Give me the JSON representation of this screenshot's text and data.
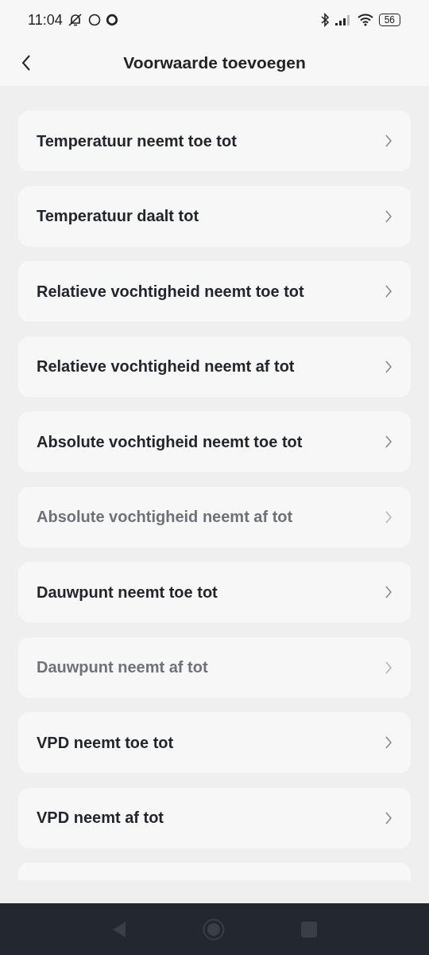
{
  "status_bar": {
    "time": "11:04",
    "battery": "56"
  },
  "header": {
    "title": "Voorwaarde toevoegen"
  },
  "conditions": [
    {
      "label": "Temperatuur neemt toe tot",
      "disabled": false
    },
    {
      "label": "Temperatuur daalt tot",
      "disabled": false
    },
    {
      "label": "Relatieve vochtigheid neemt toe tot",
      "disabled": false
    },
    {
      "label": "Relatieve vochtigheid neemt af tot",
      "disabled": false
    },
    {
      "label": "Absolute vochtigheid neemt toe tot",
      "disabled": false
    },
    {
      "label": "Absolute vochtigheid neemt af tot",
      "disabled": true
    },
    {
      "label": "Dauwpunt neemt toe tot",
      "disabled": false
    },
    {
      "label": "Dauwpunt neemt af tot",
      "disabled": true
    },
    {
      "label": "VPD neemt toe tot",
      "disabled": false
    },
    {
      "label": "VPD neemt af tot",
      "disabled": false
    }
  ]
}
